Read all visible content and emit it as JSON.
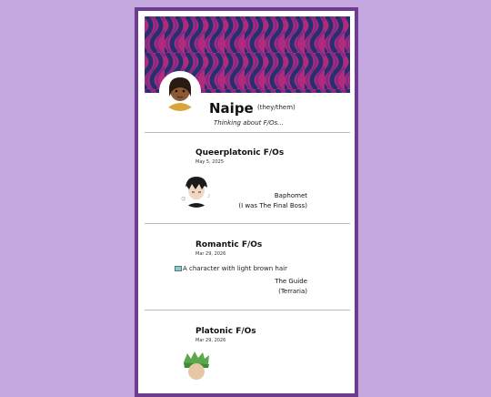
{
  "profile": {
    "name": "Naipe",
    "pronouns": "(they/them)",
    "status": "Thinking about F/Os..."
  },
  "sections": [
    {
      "title": "Queerplatonic F/Os",
      "date": "May 5, 2025",
      "character": {
        "name": "Baphomet",
        "source": "(I was The Final Boss)"
      }
    },
    {
      "title": "Romantic F/Os",
      "date": "Mar 29, 2026",
      "image_alt": "A character with light brown hair",
      "character": {
        "name": "The Guide",
        "source": "(Terraria)"
      }
    },
    {
      "title": "Platonic F/Os",
      "date": "Mar 29, 2026"
    }
  ],
  "colors": {
    "page_background": "#c5a8e0",
    "card_border": "#6b3d8f",
    "banner_magenta": "#b32a7d",
    "banner_navy": "#27306e"
  }
}
